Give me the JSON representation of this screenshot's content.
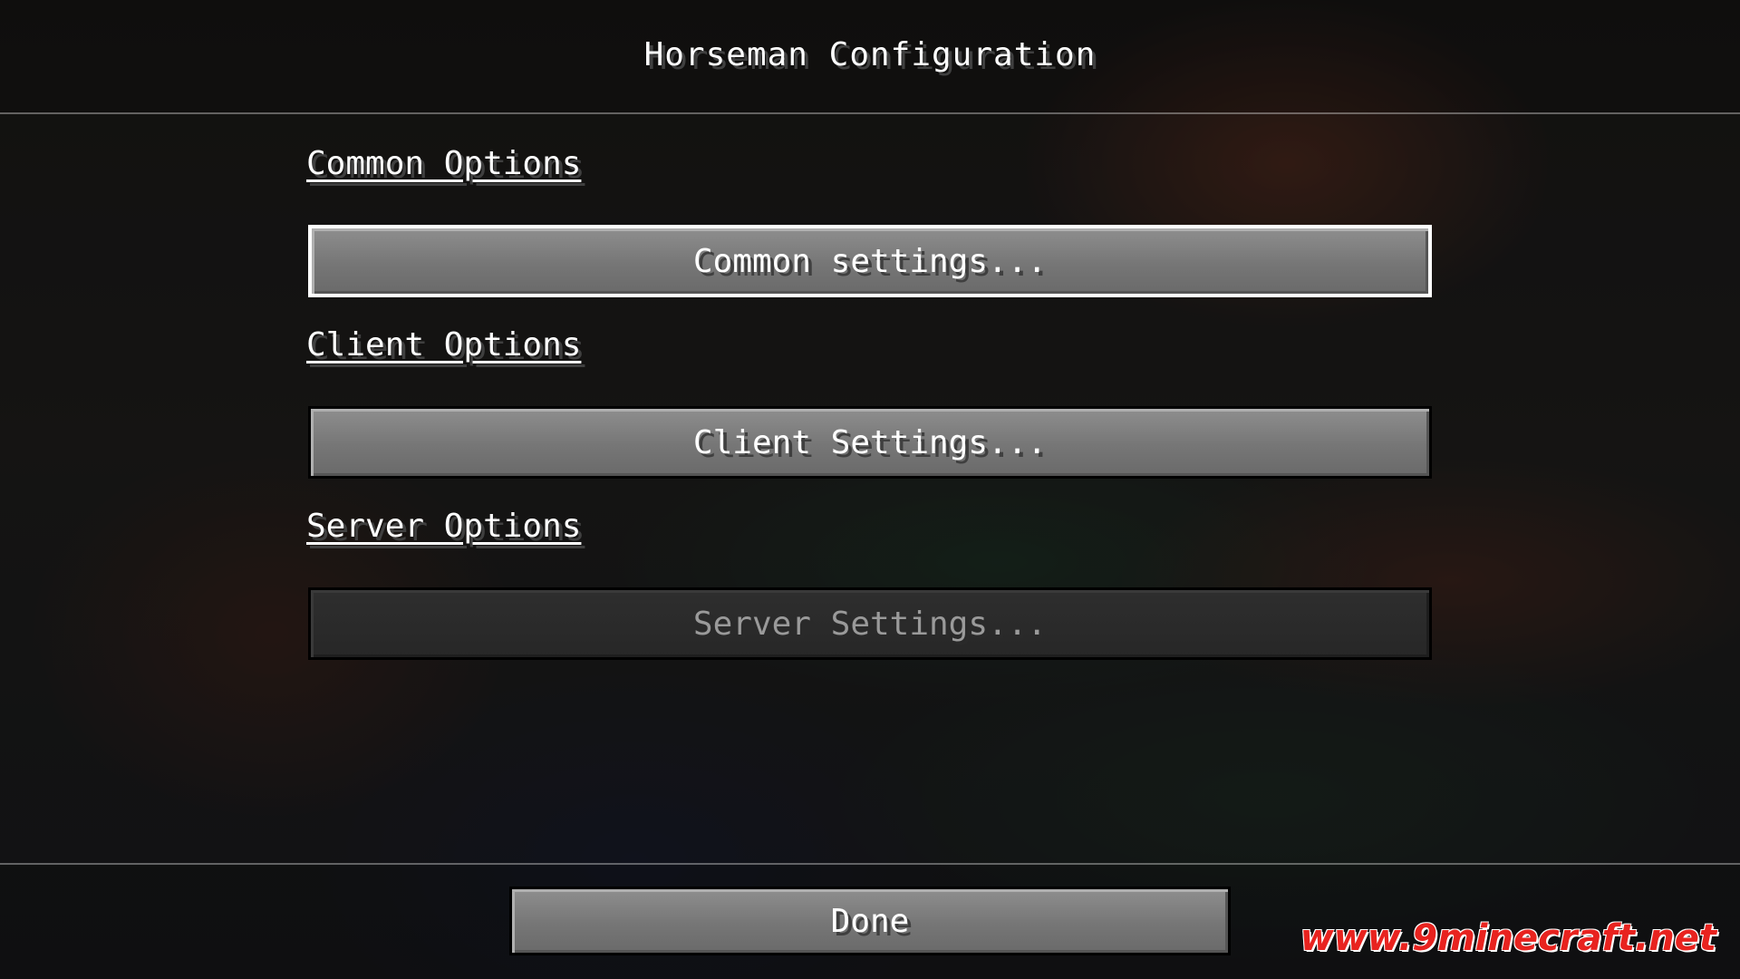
{
  "screen": {
    "title": "Horseman Configuration"
  },
  "sections": [
    {
      "label": "Common Options",
      "button": {
        "label": "Common settings...",
        "state": "focused"
      }
    },
    {
      "label": "Client Options",
      "button": {
        "label": "Client Settings...",
        "state": "normal"
      }
    },
    {
      "label": "Server Options",
      "button": {
        "label": "Server Settings...",
        "state": "disabled"
      }
    }
  ],
  "footer": {
    "done_label": "Done"
  },
  "watermark": {
    "text": "www.9minecraft.net",
    "color": "#e8231f"
  },
  "colors": {
    "text": "#ffffff",
    "text_shadow": "#3f3f3f",
    "disabled_text": "#9a9a9a",
    "focus_border": "#ffffff"
  }
}
